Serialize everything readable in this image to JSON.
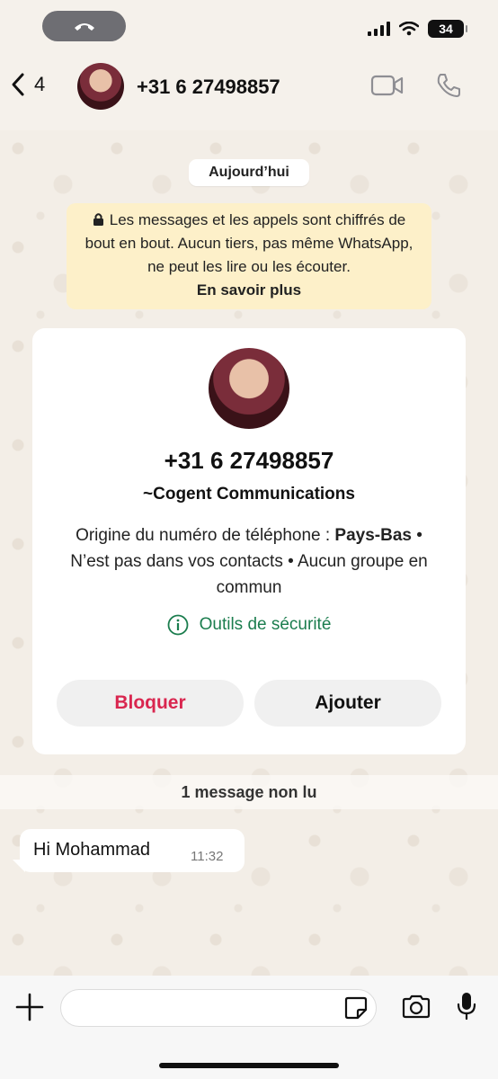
{
  "status_bar": {
    "battery": "34"
  },
  "header": {
    "back_count": "4",
    "title": "+31 6 27498857"
  },
  "date_chip": "Aujourd’hui",
  "notice": {
    "text": "Les messages et les appels sont chiffrés de bout en bout. Aucun tiers, pas même WhatsApp, ne peut les lire ou les écouter.",
    "link": "En savoir plus"
  },
  "card": {
    "number": "+31 6 27498857",
    "name": "~Cogent Communications",
    "origin_prefix": "Origine du numéro de téléphone : ",
    "origin_country": "Pays-Bas",
    "info_rest": " • N’est pas dans vos contacts • Aucun groupe en commun",
    "security_label": "Outils de sécurité",
    "block_label": "Bloquer",
    "add_label": "Ajouter"
  },
  "unread_banner": "1 message non lu",
  "message": {
    "text": "Hi Mohammad",
    "time": "11:32"
  },
  "input": {
    "placeholder": ""
  },
  "colors": {
    "accent_green": "#1b7d4e",
    "block_red": "#d9264f",
    "notice_bg": "#fdf0c9"
  }
}
